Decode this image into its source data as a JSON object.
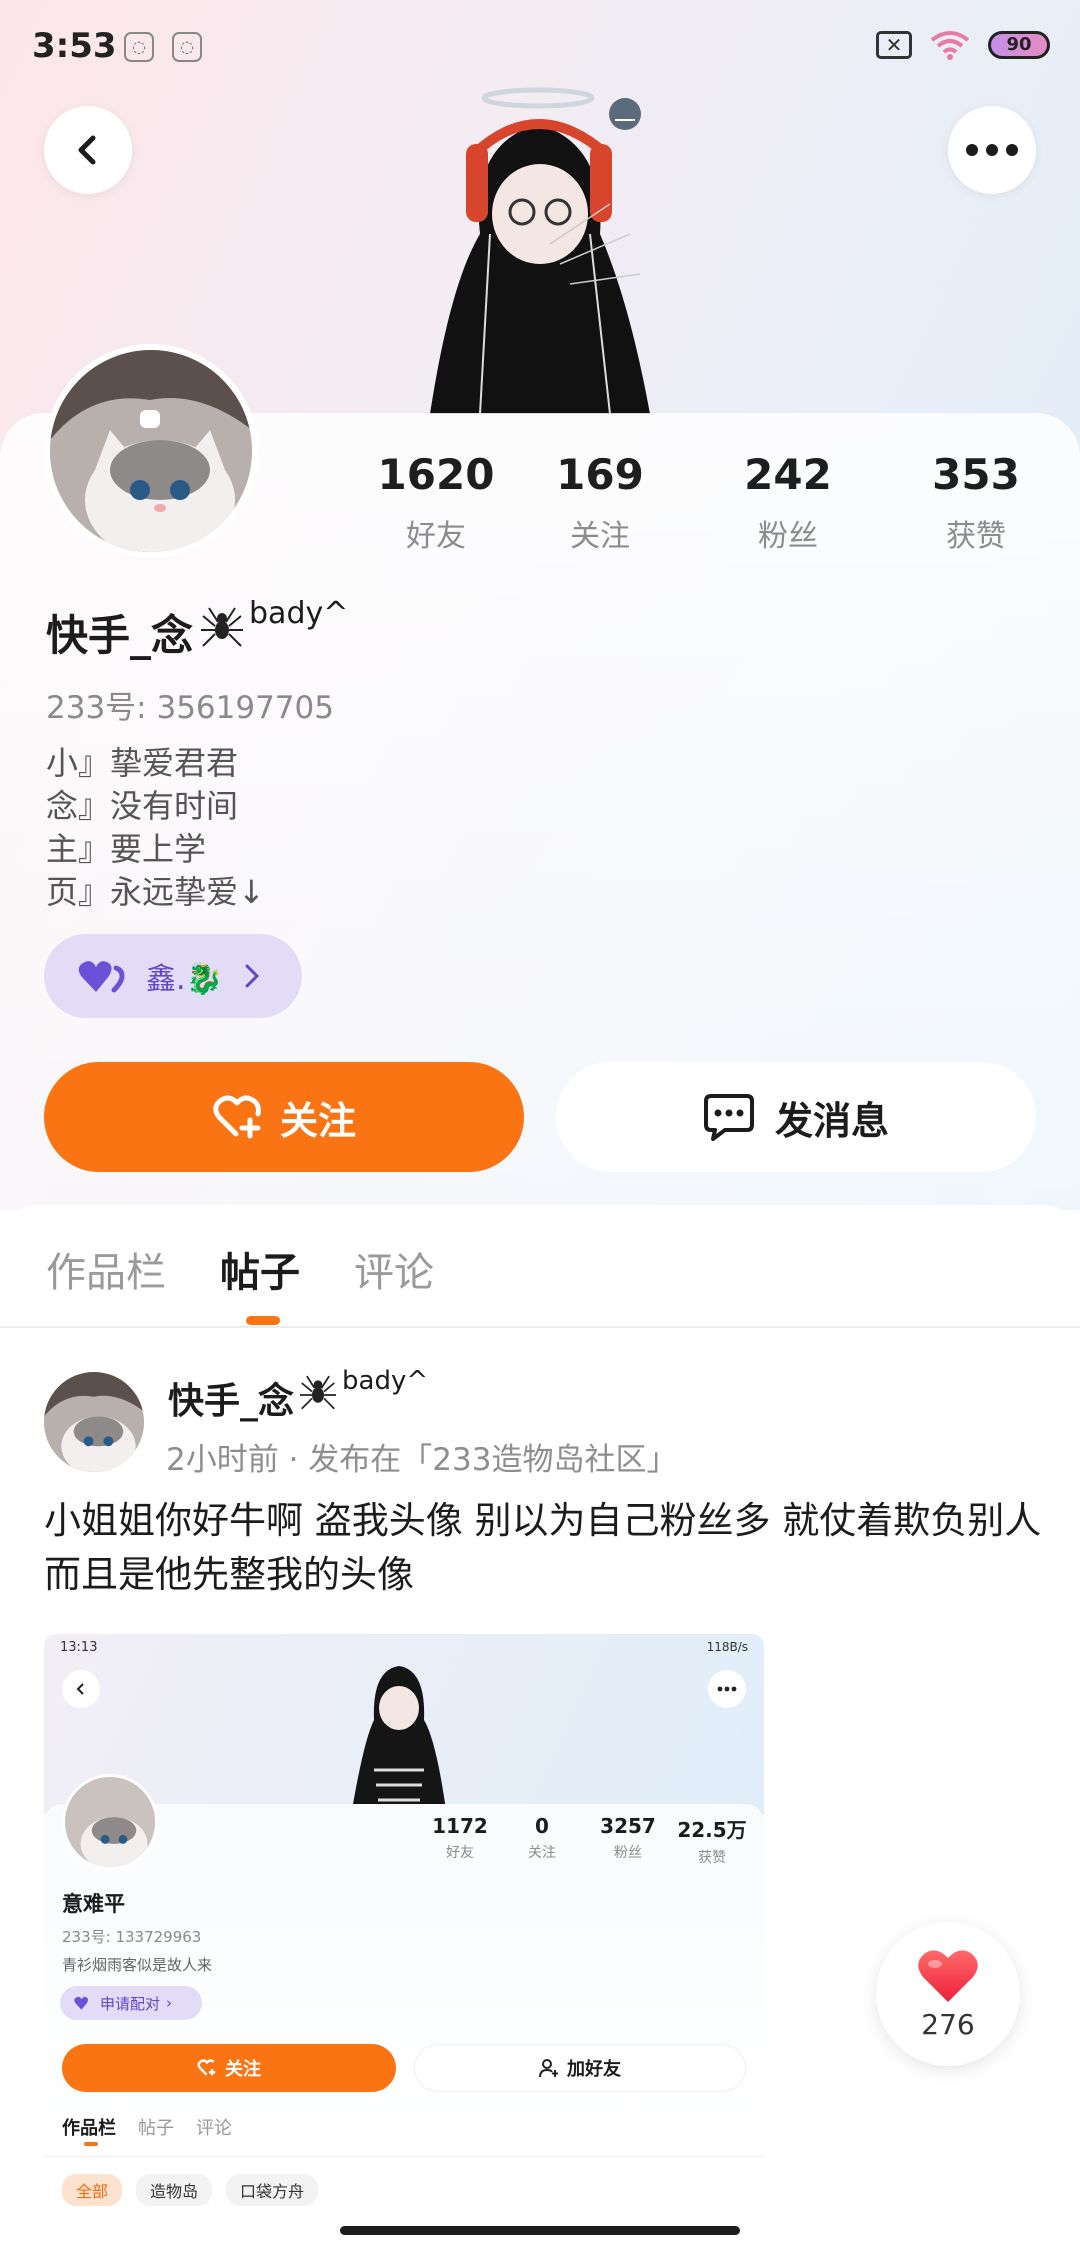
{
  "status_bar": {
    "time": "3:53",
    "battery": "90"
  },
  "profile": {
    "name": "快手_念",
    "name_suffix": "bady^",
    "uid": "233号: 356197705",
    "bio": [
      "小』挚爱君君",
      "念』没有时间",
      "主』要上学",
      "页』永远挚爱↓"
    ],
    "stats": [
      {
        "value": "1620",
        "label": "好友"
      },
      {
        "value": "169",
        "label": "关注"
      },
      {
        "value": "242",
        "label": "粉丝"
      },
      {
        "value": "353",
        "label": "获赞"
      }
    ],
    "cp_name": "鑫.🐉"
  },
  "actions": {
    "follow_label": "关注",
    "message_label": "发消息"
  },
  "tabs": [
    {
      "label": "作品栏",
      "active": false
    },
    {
      "label": "帖子",
      "active": true
    },
    {
      "label": "评论",
      "active": false
    }
  ],
  "post": {
    "author": "快手_念",
    "author_suffix": "bady^",
    "meta": "2小时前 · 发布在「233造物岛社区」",
    "text": "小姐姐你好牛啊 盗我头像 别以为自己粉丝多 就仗着欺负别人 而且是他先整我的头像",
    "like_count": "276",
    "embedded_screenshot": {
      "time": "13:13",
      "net": "118B/s",
      "name": "意难平",
      "uid": "233号: 133729963",
      "bio": "青衫烟雨客似是故人来",
      "pill": "申请配对",
      "follow": "关注",
      "add_friend": "加好友",
      "stats": [
        {
          "value": "1172",
          "label": "好友"
        },
        {
          "value": "0",
          "label": "关注"
        },
        {
          "value": "3257",
          "label": "粉丝"
        },
        {
          "value": "22.5万",
          "label": "获赞"
        }
      ],
      "tabs": [
        "作品栏",
        "帖子",
        "评论"
      ],
      "chips": [
        "全部",
        "造物岛",
        "口袋方舟"
      ]
    }
  },
  "colors": {
    "accent": "#fa7414",
    "cp_purple": "#5e48c9",
    "like_red": "#f5323e"
  }
}
